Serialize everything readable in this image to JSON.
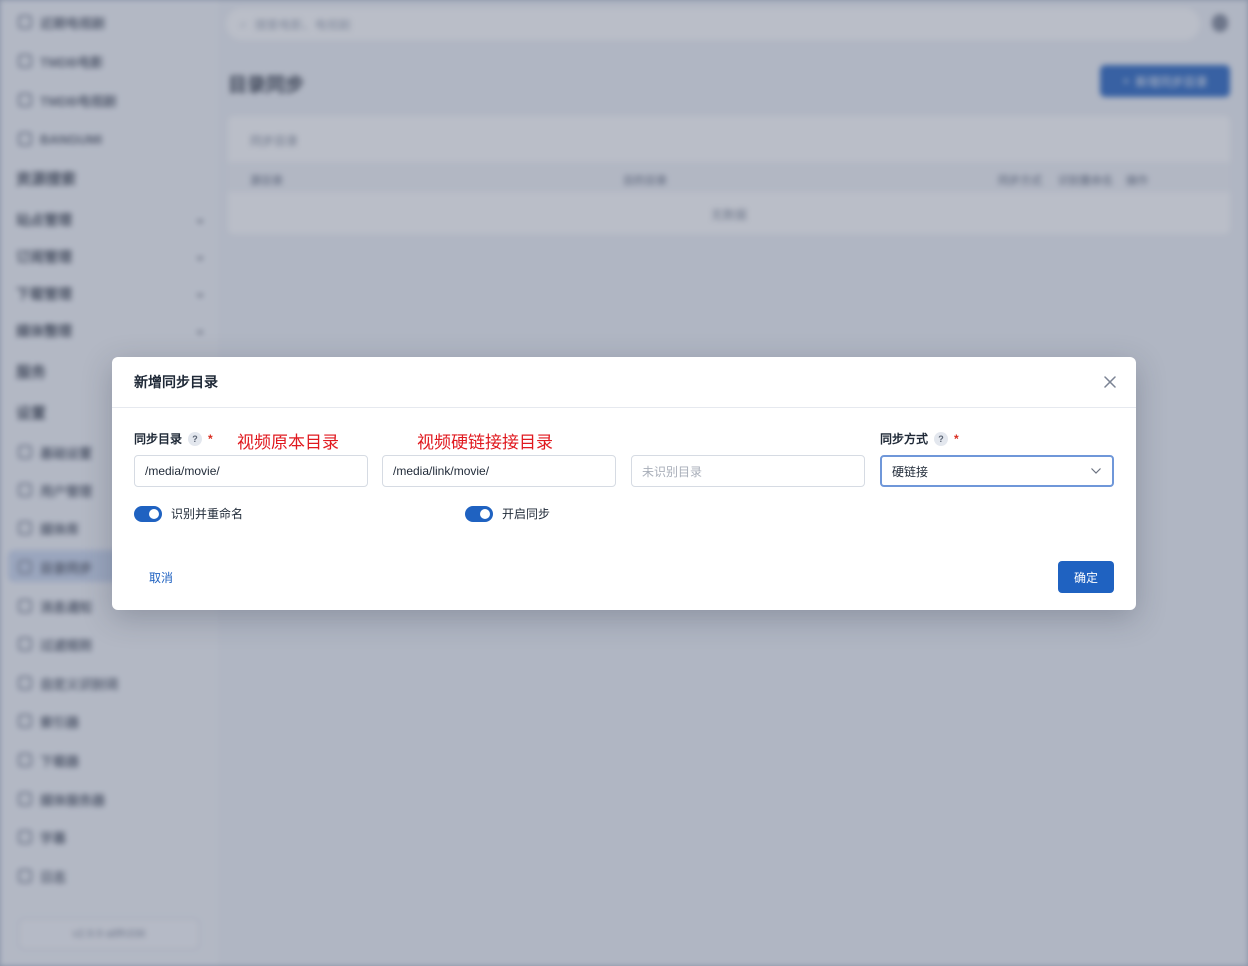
{
  "background": {
    "sidebar": {
      "top_items": [
        "近期电视剧",
        "TMDB电影",
        "TMDB电视剧",
        "BANGUMI"
      ],
      "section_resources": "资源搜索",
      "groups": [
        "站点管理",
        "订阅管理",
        "下载管理",
        "媒体整理"
      ],
      "section_services": "服务",
      "section_settings": "设置",
      "setting_items": [
        "基础设置",
        "用户管理",
        "媒体库",
        "目录同步",
        "消息通知",
        "过滤规则",
        "自定义识别词",
        "索引器",
        "下载器",
        "媒体服务器",
        "字幕",
        "日志"
      ],
      "version": "v2.9.9 a8fh336"
    },
    "search_placeholder": "搜索电影、电视剧",
    "page_title": "目录同步",
    "add_button": "新增同步目录",
    "card": {
      "title": "同步目录",
      "columns": [
        "源目录",
        "目的目录",
        "同步方式",
        "识别重命名",
        "操作"
      ],
      "empty": "无数据"
    }
  },
  "dialog": {
    "title": "新增同步目录",
    "sync_dir_label": "同步目录",
    "sync_mode_label": "同步方式",
    "help_glyph": "?",
    "required_mark": "*",
    "annotation_source": "视频原本目录",
    "annotation_link": "视频硬链接接目录",
    "source_path": "/media/movie/",
    "link_path": "/media/link/movie/",
    "unknown_placeholder": "未识别目录",
    "sync_mode_value": "硬链接",
    "toggle_rename_label": "识别并重命名",
    "toggle_rename_on": true,
    "toggle_sync_label": "开启同步",
    "toggle_sync_on": true,
    "cancel_label": "取消",
    "confirm_label": "确定"
  },
  "colors": {
    "primary": "#1f62c1",
    "annotation": "#e0191f",
    "required": "#d92d20"
  }
}
